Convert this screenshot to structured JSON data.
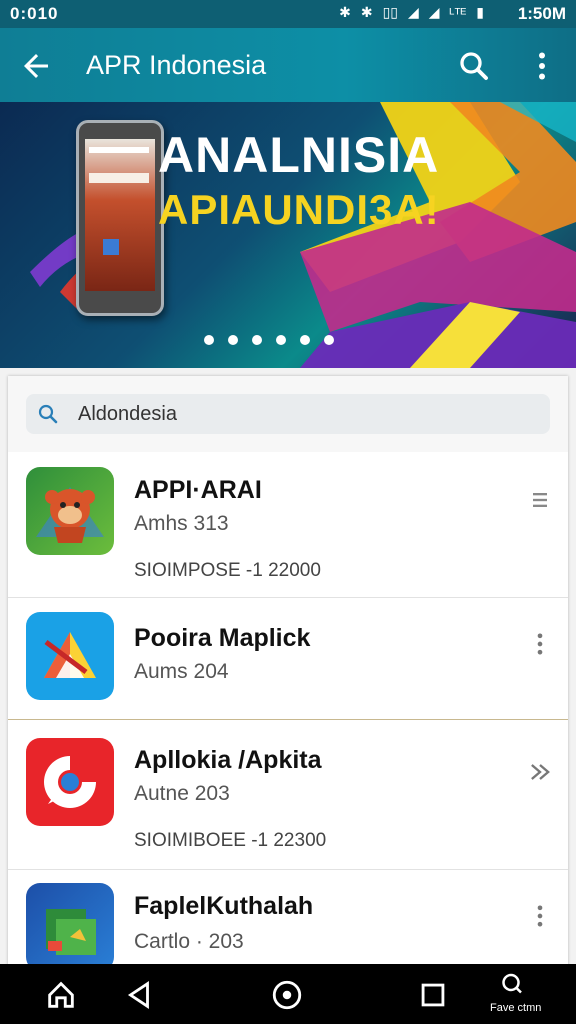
{
  "status_bar": {
    "time": "0:010",
    "indicators": [
      "✱",
      "✱",
      "▯▯",
      "◢",
      "◢",
      "▮"
    ],
    "signal_text": "ᴸᵀᴱ",
    "clock": "1:50M"
  },
  "app_bar": {
    "title": "APR Indonesia"
  },
  "banner": {
    "line1": "ANALNISIA",
    "line2": "APIAUNDI3A!",
    "page_dots": 6,
    "active_dot": 0
  },
  "search": {
    "value": "Aldondesia"
  },
  "apps": [
    {
      "name": "APPI·ARAI",
      "subtitle": "Amhs 313",
      "meta": "SIOIMPOSE -1 22000",
      "menu_icon": "lines-icon"
    },
    {
      "name": "Pooira Maplick",
      "subtitle": "Aums 204",
      "meta": "",
      "menu_icon": "kebab-icon"
    },
    {
      "name": "Apllokia /Apkita",
      "subtitle": "Autne 203",
      "meta": "SIOIMIBOEE -1 22300",
      "menu_icon": "arrows-icon"
    },
    {
      "name": "FaplelKuthalah",
      "subtitle": "Cartlo · 203",
      "meta": "",
      "menu_icon": "kebab-icon"
    }
  ],
  "nav": {
    "right_label": "Fave ctmn"
  },
  "colors": {
    "app_bar": "#0d8fa6",
    "banner_yellow": "#f6d321",
    "nav": "#000000"
  }
}
